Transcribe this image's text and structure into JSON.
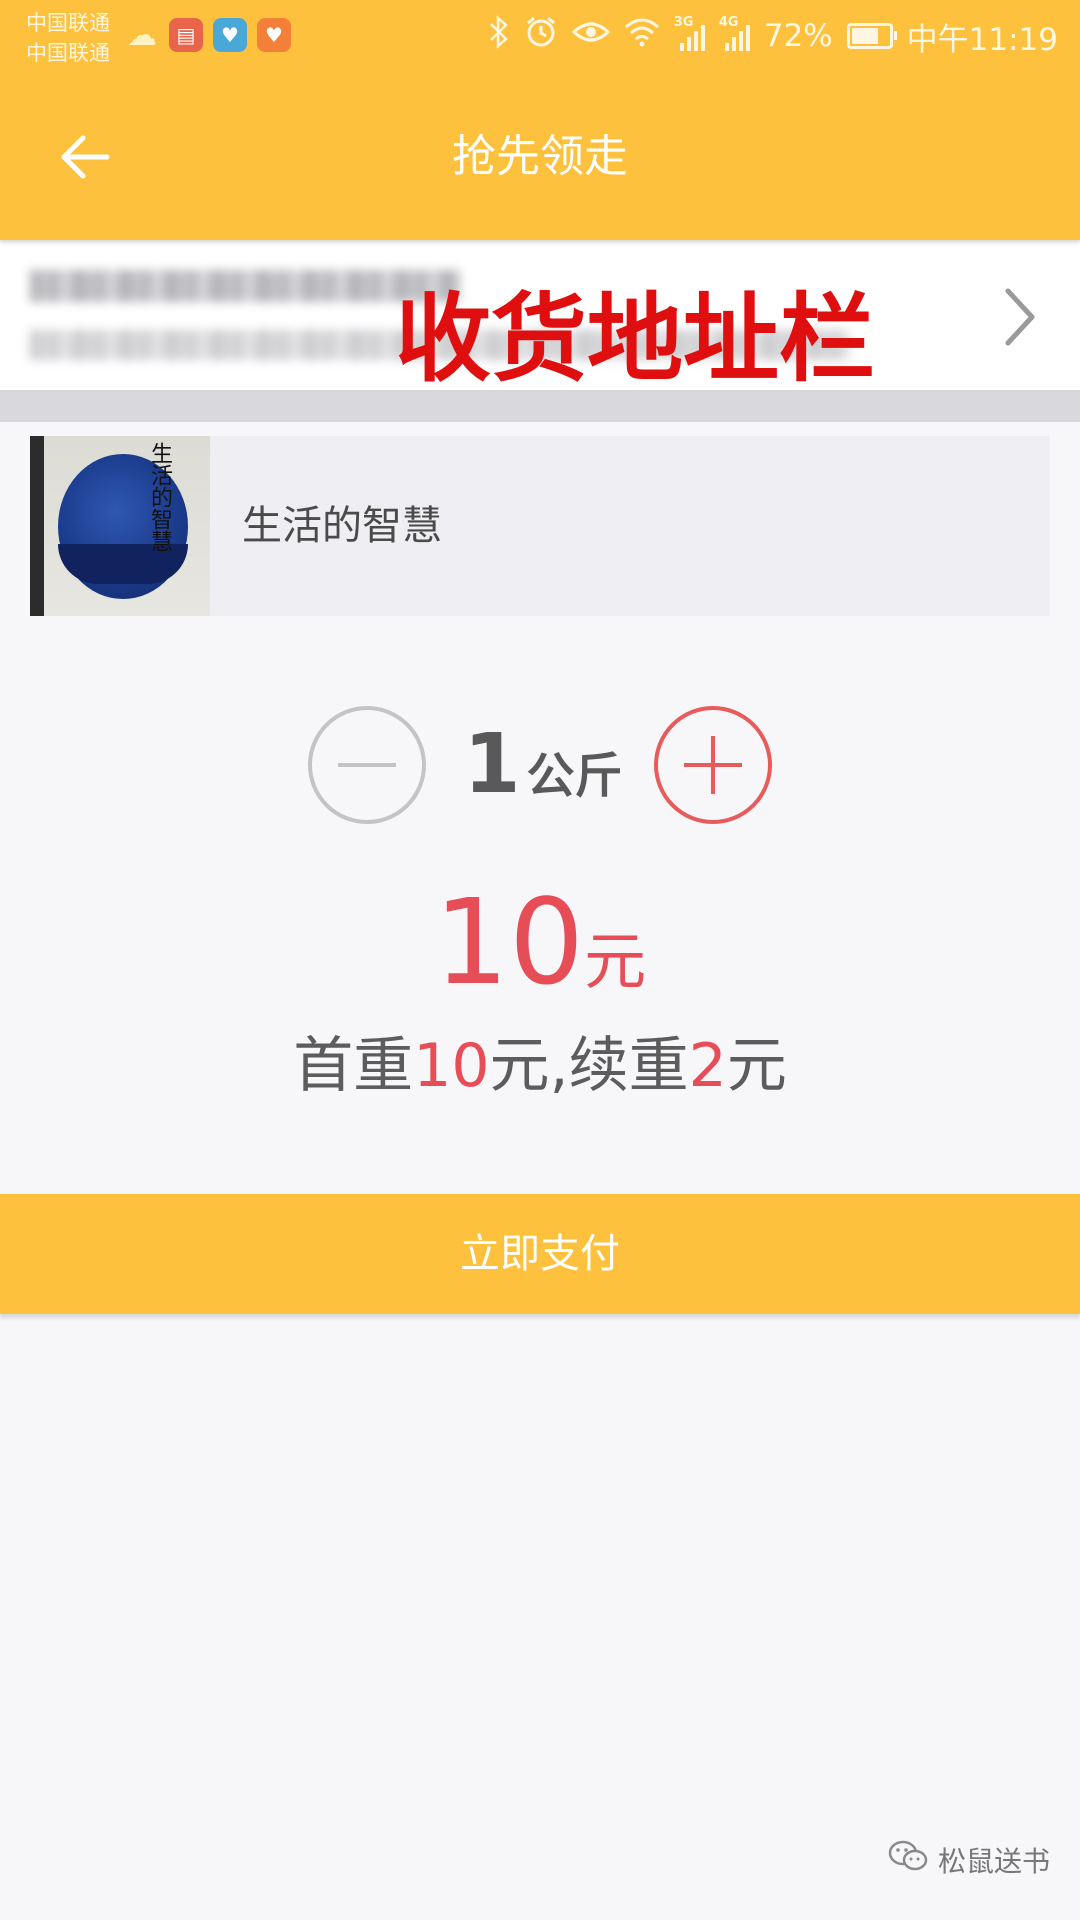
{
  "status_bar": {
    "carrier_1": "中国联通",
    "carrier_2": "中国联通",
    "app_icons": [
      "weather-icon",
      "book-app-icon",
      "reader-app-icon",
      "health-app-icon"
    ],
    "network_1": "3G",
    "network_2": "4G",
    "battery": "72%",
    "battery_level": 0.72,
    "time": "中午11:19"
  },
  "header": {
    "title": "抢先领走",
    "back_icon": "arrow-left-icon"
  },
  "address": {
    "annotation": "收货地址栏",
    "chevron_icon": "chevron-right-icon"
  },
  "product": {
    "title": "生活的智慧",
    "cover_text": "生活的智慧"
  },
  "quantity": {
    "value": "1",
    "unit": "公斤"
  },
  "price": {
    "value": "10",
    "unit": "元"
  },
  "shipping_rule": {
    "first_label": "首重",
    "first_value": "10",
    "first_unit": "元,",
    "extra_label": "续重",
    "extra_value": "2",
    "extra_unit": "元"
  },
  "pay_button": {
    "label": "立即支付"
  },
  "watermark": {
    "text": "松鼠送书"
  },
  "colors": {
    "primary": "#fec13e",
    "accent_red": "#e74d57",
    "annotation_red": "#e00f0f"
  }
}
